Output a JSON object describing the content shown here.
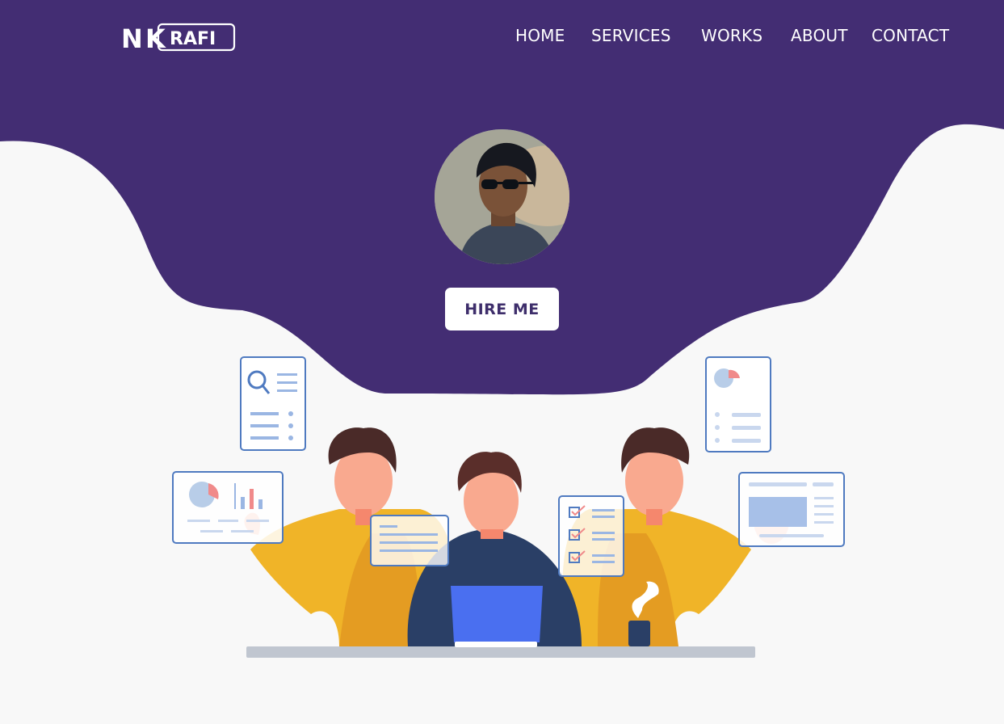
{
  "header": {
    "logo": {
      "text_prefix": "N",
      "text_k": "K",
      "text_suffix": "RAFI"
    },
    "nav": [
      {
        "label": "HOME"
      },
      {
        "label": "SERVICES"
      },
      {
        "label": "WORKS"
      },
      {
        "label": "ABOUT"
      },
      {
        "label": "CONTACT"
      }
    ]
  },
  "hero": {
    "avatar": {
      "description": "profile-photo"
    },
    "cta_label": "HIRE ME"
  },
  "colors": {
    "hero_purple": "#432d73",
    "page_bg": "#f8f8f8",
    "cta_text": "#3e2e6b",
    "shirt_yellow": "#f0b428",
    "laptop_blue": "#4a6ff0",
    "doc_border": "#4f7ac0"
  }
}
